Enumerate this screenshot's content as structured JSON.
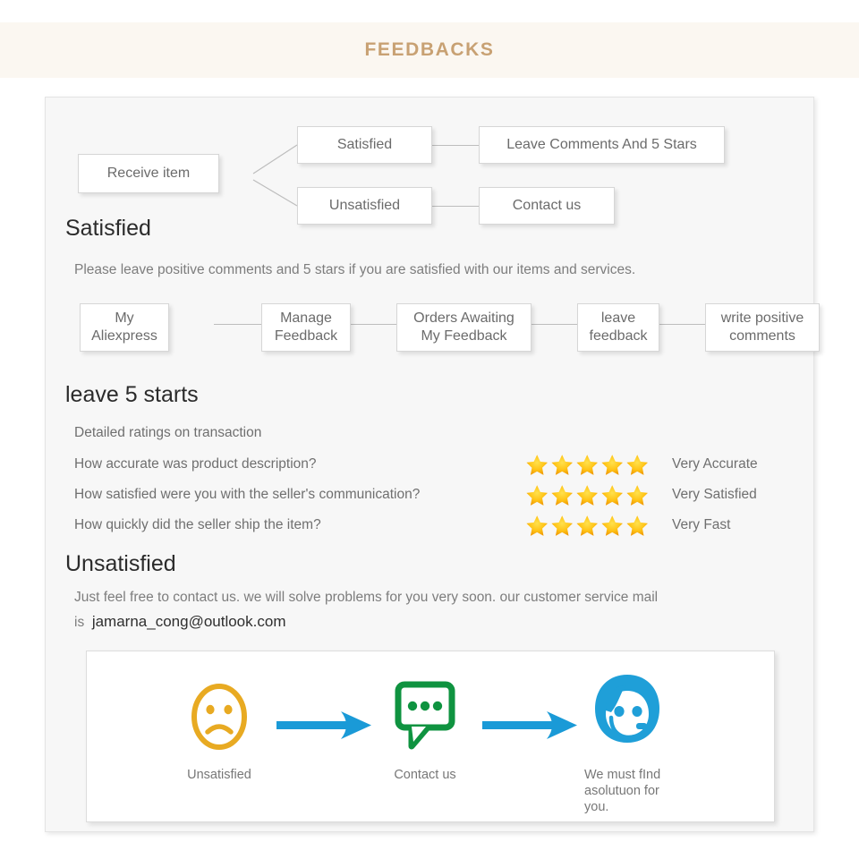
{
  "banner": {
    "title": "FEEDBACKS"
  },
  "decision_flow": {
    "start": "Receive item",
    "branches": [
      {
        "condition": "Satisfied",
        "action": "Leave Comments And 5 Stars"
      },
      {
        "condition": "Unsatisfied",
        "action": "Contact us"
      }
    ]
  },
  "satisfied": {
    "heading": "Satisfied",
    "paragraph": "Please leave positive comments and 5 stars if you are satisfied with our items and services.",
    "steps": [
      "My\nAliexpress",
      "Manage\nFeedback",
      "Orders Awaiting\nMy Feedback",
      "leave\nfeedback",
      "write positive\ncomments"
    ]
  },
  "ratings": {
    "heading": "leave 5 starts",
    "subtitle": "Detailed ratings on transaction",
    "star_count": 5,
    "star_color": "#f5a623",
    "rows": [
      {
        "question": "How accurate was product description?",
        "stars": 5,
        "label": "Very Accurate"
      },
      {
        "question": "How satisfied were you with the seller's communication?",
        "stars": 5,
        "label": "Very Satisfied"
      },
      {
        "question": "How quickly did the seller ship the item?",
        "stars": 5,
        "label": "Very Fast"
      }
    ]
  },
  "unsatisfied": {
    "heading": "Unsatisfied",
    "paragraph": "Just feel free to contact us. we will solve problems for you very soon. our customer service mail is",
    "email": "jamarna_cong@outlook.com"
  },
  "illustration": {
    "steps": [
      {
        "icon": "sad-face-icon",
        "caption": "Unsatisfied",
        "color": "#e8aa22"
      },
      {
        "icon": "chat-bubble-icon",
        "caption": "Contact us",
        "color": "#0f9340"
      },
      {
        "icon": "support-agent-icon",
        "caption": "We must fInd\nasolutuon for\nyou.",
        "color": "#1f9fd8"
      }
    ],
    "arrow_color": "#1a9ad7"
  }
}
